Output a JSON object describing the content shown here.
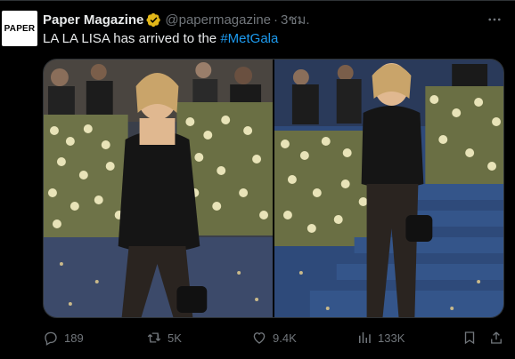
{
  "post": {
    "avatar_text": "PAPER",
    "display_name": "Paper Magazine",
    "handle": "@papermagazine",
    "separator": "·",
    "time": "3ชม.",
    "text_prefix": "LA LA LISA has arrived to the ",
    "hashtag": "#MetGala"
  },
  "icons": {
    "verified": "verified-gold-badge-icon",
    "more": "more-horizontal-icon",
    "reply": "reply-icon",
    "repost": "repost-icon",
    "like": "like-icon",
    "views": "views-icon",
    "bookmark": "bookmark-icon",
    "share": "share-icon"
  },
  "stats": {
    "replies": "189",
    "reposts": "5K",
    "likes": "9.4K",
    "views": "133K"
  },
  "colors": {
    "background": "#000000",
    "text": "#e7e9ea",
    "muted": "#71767b",
    "link": "#1d9bf0",
    "verified_gold": "#e2b719"
  }
}
